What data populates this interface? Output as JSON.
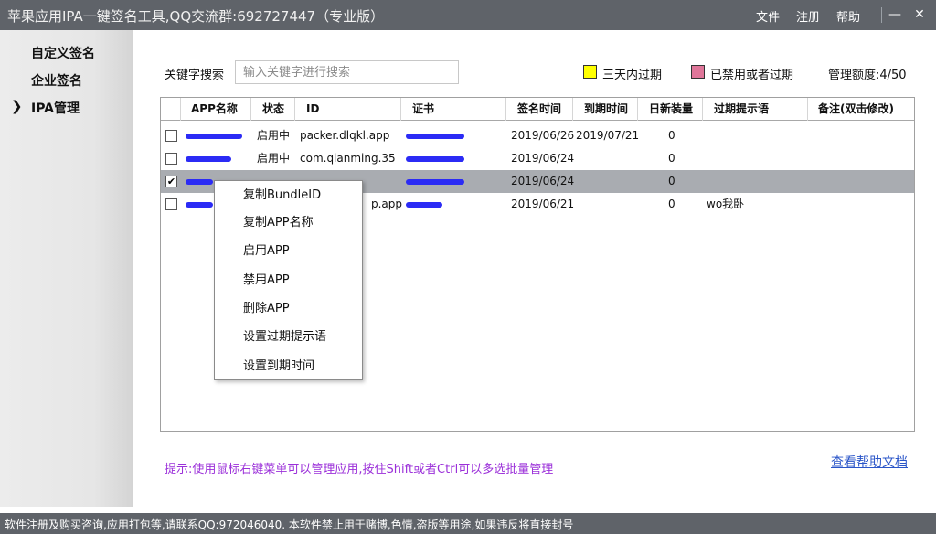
{
  "titlebar": {
    "title": "苹果应用IPA一键签名工具,QQ交流群:692727447（专业版）",
    "menu": [
      "文件",
      "注册",
      "帮助"
    ],
    "minimize": "—",
    "close": "✕"
  },
  "sidebar": {
    "items": [
      {
        "label": "自定义签名",
        "active": false
      },
      {
        "label": "企业签名",
        "active": false
      },
      {
        "label": "IPA管理",
        "active": true,
        "arrow": "❯"
      }
    ]
  },
  "search": {
    "label": "关键字搜索",
    "placeholder": "输入关键字进行搜索",
    "value": ""
  },
  "legend": {
    "expire_soon": {
      "label": "三天内过期",
      "color": "#ffff00"
    },
    "disabled": {
      "label": "已禁用或者过期",
      "color": "#e0769a"
    }
  },
  "quota": "管理额度:4/50",
  "table": {
    "columns": [
      "APP名称",
      "状态",
      "ID",
      "证书",
      "签名时间",
      "到期时间",
      "日新装量",
      "过期提示语",
      "备注(双击修改)"
    ],
    "rows": [
      {
        "checked": false,
        "selected": false,
        "status": "启用中",
        "id": "packer.dlqkl.app",
        "sign_time": "2019/06/26",
        "expire_time": "2019/07/21",
        "daily": "0",
        "tip": "",
        "note": ""
      },
      {
        "checked": false,
        "selected": false,
        "status": "启用中",
        "id": "com.qianming.35",
        "sign_time": "2019/06/24",
        "expire_time": "",
        "daily": "0",
        "tip": "",
        "note": ""
      },
      {
        "checked": true,
        "selected": true,
        "status": "",
        "id": "",
        "sign_time": "2019/06/24",
        "expire_time": "",
        "daily": "0",
        "tip": "",
        "note": ""
      },
      {
        "checked": false,
        "selected": false,
        "status": "",
        "id": "p.app",
        "sign_time": "2019/06/21",
        "expire_time": "",
        "daily": "0",
        "tip": "wo我卧",
        "note": ""
      }
    ]
  },
  "context_menu": {
    "items": [
      "复制BundleID",
      "复制APP名称",
      "启用APP",
      "禁用APP",
      "删除APP",
      "设置过期提示语",
      "设置到期时间"
    ]
  },
  "tip": "提示:使用鼠标右键菜单可以管理应用,按住Shift或者Ctrl可以多选批量管理",
  "help_link": "查看帮助文档",
  "statusbar": "软件注册及购买咨询,应用打包等,请联系QQ:972046040.  本软件禁止用于赌博,色情,盗版等用途,如果违反将直接封号",
  "check_glyph": "✔"
}
